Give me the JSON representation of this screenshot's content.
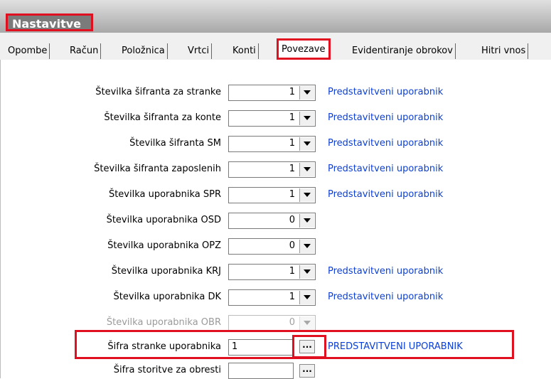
{
  "window": {
    "title": "Nastavitve"
  },
  "tabs": [
    {
      "label": "Opombe"
    },
    {
      "label": "Račun"
    },
    {
      "label": "Položnica"
    },
    {
      "label": "Vrtci"
    },
    {
      "label": "Konti"
    },
    {
      "label": "Povezave"
    },
    {
      "label": "Evidentiranje obrokov"
    },
    {
      "label": "Hitri vnos"
    }
  ],
  "rows": [
    {
      "label": "Številka šifranta za stranke",
      "value": "1",
      "link": "Predstavitveni uporabnik"
    },
    {
      "label": "Številka šifranta za konte",
      "value": "1",
      "link": "Predstavitveni uporabnik"
    },
    {
      "label": "Številka šifranta SM",
      "value": "1",
      "link": "Predstavitveni uporabnik"
    },
    {
      "label": "Številka šifranta zaposlenih",
      "value": "1",
      "link": "Predstavitveni uporabnik"
    },
    {
      "label": "Številka uporabnika SPR",
      "value": "1",
      "link": "Predstavitveni uporabnik"
    },
    {
      "label": "Številka uporabnika OSD",
      "value": "0"
    },
    {
      "label": "Številka uporabnika OPZ",
      "value": "0"
    },
    {
      "label": "Številka uporabnika KRJ",
      "value": "1",
      "link": "Predstavitveni uporabnik"
    },
    {
      "label": "Številka uporabnika DK",
      "value": "1",
      "link": "Predstavitveni uporabnik"
    },
    {
      "label": "Številka uporabnika OBR",
      "value": "0"
    }
  ],
  "sifra_stranke": {
    "label": "Šifra stranke uporabnika",
    "value": "1",
    "button": "...",
    "link": "PREDSTAVITVENI UPORABNIK"
  },
  "sifra_storitve": {
    "label": "Šifra storitve za obresti",
    "value": "",
    "button": "..."
  },
  "colors": {
    "highlight": "#e01020",
    "link": "#0b3fd6"
  }
}
